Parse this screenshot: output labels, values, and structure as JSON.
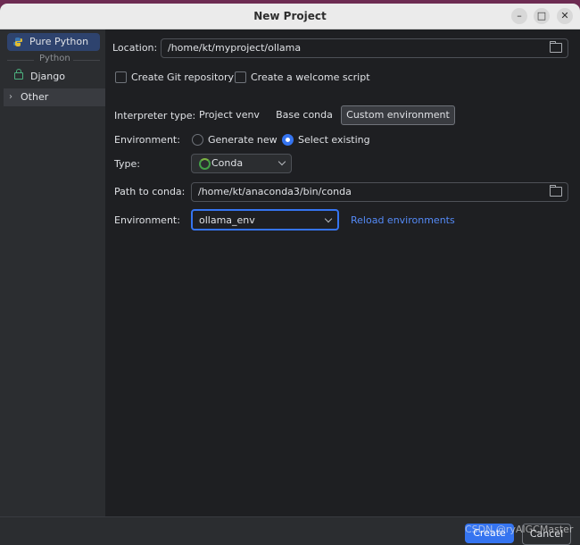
{
  "window": {
    "title": "New Project"
  },
  "sidebar": {
    "items": [
      {
        "label": "Pure Python",
        "icon": "python-icon",
        "selected": true
      },
      {
        "label": "Django",
        "icon": "lock-icon"
      },
      {
        "label": "Other",
        "icon": "chevron-right-icon"
      }
    ],
    "group_label": "Python"
  },
  "form": {
    "location_label": "Location:",
    "location_value": "/home/kt/myproject/ollama",
    "create_git_label": "Create Git repository",
    "welcome_script_label": "Create a welcome script",
    "interpreter_label": "Interpreter type:",
    "interpreter_options": [
      "Project venv",
      "Base conda",
      "Custom environment"
    ],
    "interpreter_selected": "Custom environment",
    "environment_label": "Environment:",
    "env_generate_label": "Generate new",
    "env_select_label": "Select existing",
    "type_label": "Type:",
    "type_value": "Conda",
    "conda_path_label": "Path to conda:",
    "conda_path_value": "/home/kt/anaconda3/bin/conda",
    "env_select_label2": "Environment:",
    "env_select_value": "ollama_env",
    "reload_link": "Reload environments"
  },
  "footer": {
    "create_label": "Create",
    "cancel_label": "Cancel"
  },
  "watermark": "CSDN @ryAIGCMaster",
  "colors": {
    "accent": "#3574f0",
    "background": "#1e1f22",
    "panel": "#2b2d30",
    "link": "#548af7"
  }
}
